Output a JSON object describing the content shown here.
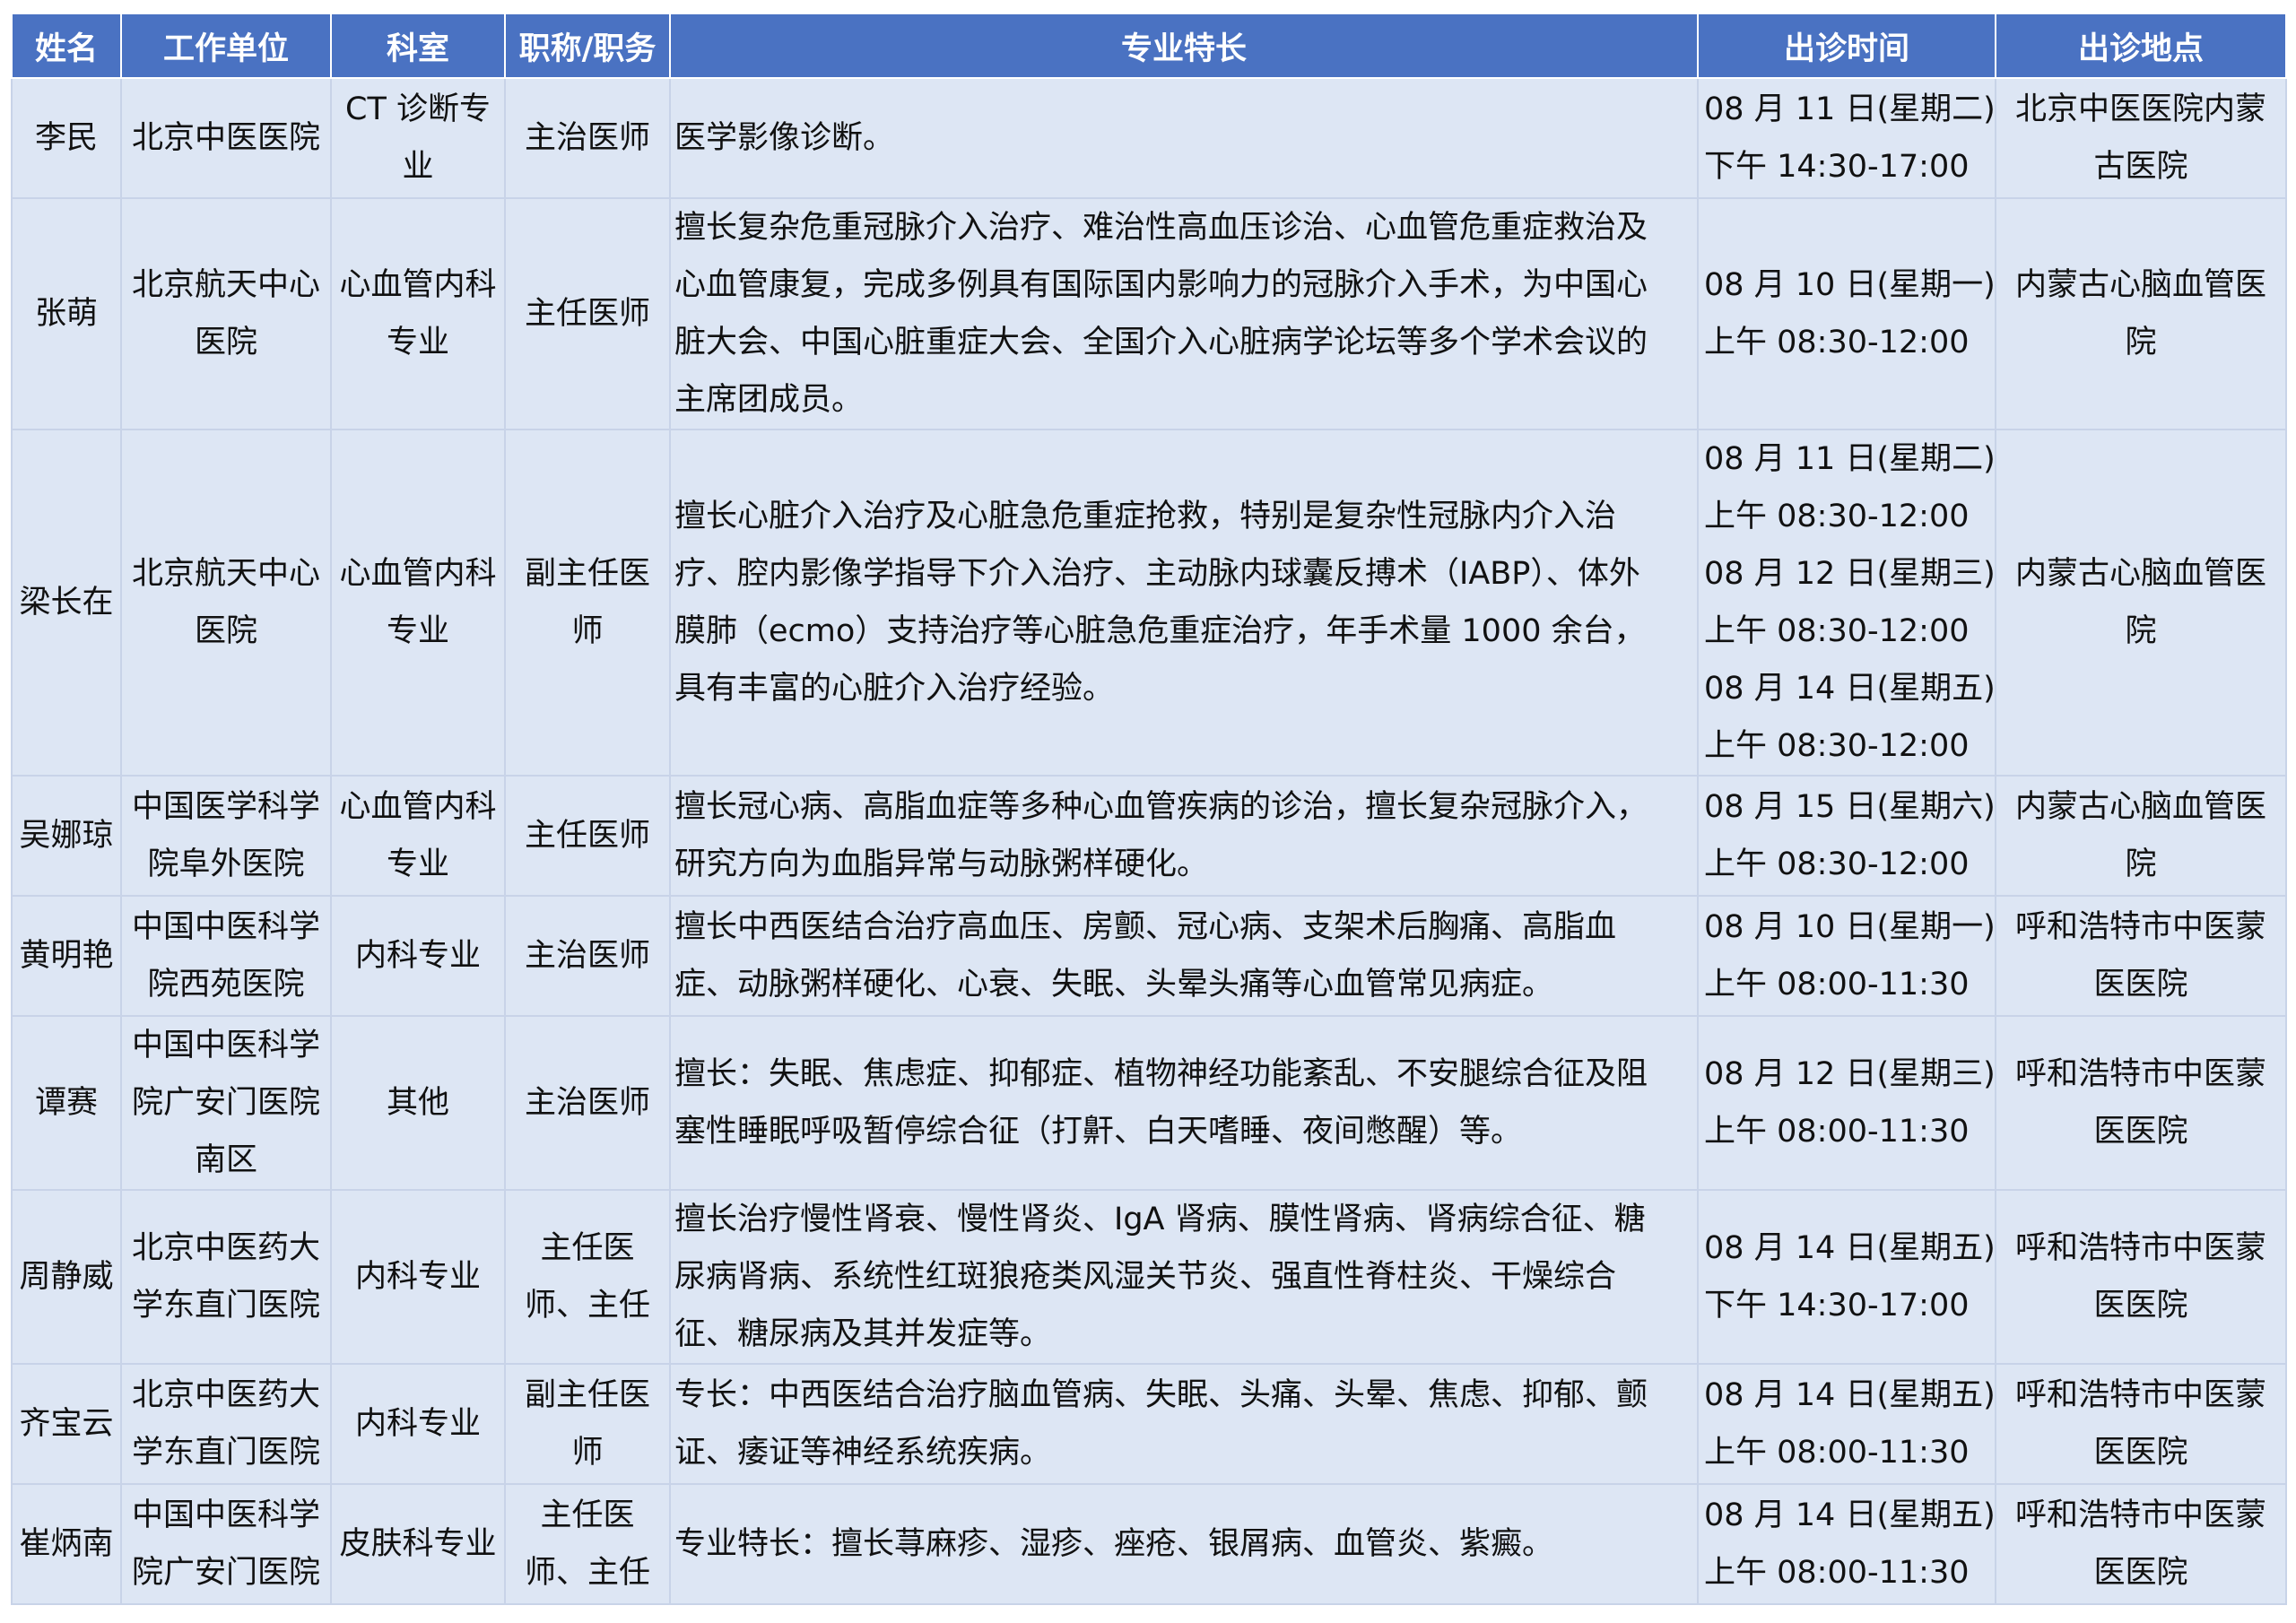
{
  "header": {
    "name": "姓名",
    "unit": "工作单位",
    "dept": "科室",
    "title": "职称/职务",
    "specialty": "专业特长",
    "time": "出诊时间",
    "place": "出诊地点"
  },
  "rows": [
    {
      "name": [
        "李民"
      ],
      "unit": [
        "北京中医医院"
      ],
      "dept": [
        "CT 诊断专",
        "业"
      ],
      "title": [
        "主治医师"
      ],
      "specialty": [
        "医学影像诊断。"
      ],
      "time": [
        "08 月 11 日(星期二)",
        "下午 14:30-17:00"
      ],
      "place": [
        "北京中医医院内蒙",
        "古医院"
      ]
    },
    {
      "name": [
        "张萌"
      ],
      "unit": [
        "北京航天中心",
        "医院"
      ],
      "dept": [
        "心血管内科",
        "专业"
      ],
      "title": [
        "主任医师"
      ],
      "specialty": [
        "擅长复杂危重冠脉介入治疗、难治性高血压诊治、心血管危重症救治及",
        "心血管康复，完成多例具有国际国内影响力的冠脉介入手术，为中国心",
        "脏大会、中国心脏重症大会、全国介入心脏病学论坛等多个学术会议的",
        "主席团成员。"
      ],
      "time": [
        "08 月 10 日(星期一)",
        "上午 08:30-12:00"
      ],
      "place": [
        "内蒙古心脑血管医",
        "院"
      ]
    },
    {
      "name": [
        "梁长在"
      ],
      "unit": [
        "北京航天中心",
        "医院"
      ],
      "dept": [
        "心血管内科",
        "专业"
      ],
      "title": [
        "副主任医",
        "师"
      ],
      "specialty": [
        "擅长心脏介入治疗及心脏急危重症抢救，特别是复杂性冠脉内介入治",
        "疗、腔内影像学指导下介入治疗、主动脉内球囊反搏术（IABP）、体外",
        "膜肺（ecmo）支持治疗等心脏急危重症治疗，年手术量 1000 余台，",
        "具有丰富的心脏介入治疗经验。"
      ],
      "time": [
        "08 月 11 日(星期二)",
        "上午 08:30-12:00",
        "08 月 12 日(星期三)",
        "上午 08:30-12:00",
        "08 月 14 日(星期五)",
        "上午 08:30-12:00"
      ],
      "place": [
        "内蒙古心脑血管医",
        "院"
      ]
    },
    {
      "name": [
        "吴娜琼"
      ],
      "unit": [
        "中国医学科学",
        "院阜外医院"
      ],
      "dept": [
        "心血管内科",
        "专业"
      ],
      "title": [
        "主任医师"
      ],
      "specialty": [
        "擅长冠心病、高脂血症等多种心血管疾病的诊治，擅长复杂冠脉介入，",
        "研究方向为血脂异常与动脉粥样硬化。"
      ],
      "time": [
        "08 月 15 日(星期六)",
        "上午 08:30-12:00"
      ],
      "place": [
        "内蒙古心脑血管医",
        "院"
      ]
    },
    {
      "name": [
        "黄明艳"
      ],
      "unit": [
        "中国中医科学",
        "院西苑医院"
      ],
      "dept": [
        "内科专业"
      ],
      "title": [
        "主治医师"
      ],
      "specialty": [
        "擅长中西医结合治疗高血压、房颤、冠心病、支架术后胸痛、高脂血",
        "症、动脉粥样硬化、心衰、失眠、头晕头痛等心血管常见病症。"
      ],
      "time": [
        "08 月 10 日(星期一)",
        "上午 08:00-11:30"
      ],
      "place": [
        "呼和浩特市中医蒙",
        "医医院"
      ]
    },
    {
      "name": [
        "谭赛"
      ],
      "unit": [
        "中国中医科学",
        "院广安门医院",
        "南区"
      ],
      "dept": [
        "其他"
      ],
      "title": [
        "主治医师"
      ],
      "specialty": [
        "擅长：失眠、焦虑症、抑郁症、植物神经功能紊乱、不安腿综合征及阻",
        "塞性睡眠呼吸暂停综合征（打鼾、白天嗜睡、夜间憋醒）等。"
      ],
      "time": [
        "08 月 12 日(星期三)",
        "上午 08:00-11:30"
      ],
      "place": [
        "呼和浩特市中医蒙",
        "医医院"
      ]
    },
    {
      "name": [
        "周静威"
      ],
      "unit": [
        "北京中医药大",
        "学东直门医院"
      ],
      "dept": [
        "内科专业"
      ],
      "title": [
        "主任医",
        "师、主任"
      ],
      "specialty": [
        "擅长治疗慢性肾衰、慢性肾炎、IgA 肾病、膜性肾病、肾病综合征、糖",
        "尿病肾病、系统性红斑狼疮类风湿关节炎、强直性脊柱炎、干燥综合",
        "征、糖尿病及其并发症等。"
      ],
      "time": [
        "08 月 14 日(星期五)",
        "下午 14:30-17:00"
      ],
      "place": [
        "呼和浩特市中医蒙",
        "医医院"
      ]
    },
    {
      "name": [
        "齐宝云"
      ],
      "unit": [
        "北京中医药大",
        "学东直门医院"
      ],
      "dept": [
        "内科专业"
      ],
      "title": [
        "副主任医",
        "师"
      ],
      "specialty": [
        "专长：中西医结合治疗脑血管病、失眠、头痛、头晕、焦虑、抑郁、颤",
        "证、痿证等神经系统疾病。"
      ],
      "time": [
        "08 月 14 日(星期五)",
        "上午 08:00-11:30"
      ],
      "place": [
        "呼和浩特市中医蒙",
        "医医院"
      ]
    },
    {
      "name": [
        "崔炳南"
      ],
      "unit": [
        "中国中医科学",
        "院广安门医院"
      ],
      "dept": [
        "皮肤科专业"
      ],
      "title": [
        "主任医",
        "师、主任"
      ],
      "specialty": [
        "专业特长：擅长荨麻疹、湿疹、痤疮、银屑病、血管炎、紫癜。"
      ],
      "time": [
        "08 月 14 日(星期五)",
        "上午 08:00-11:30"
      ],
      "place": [
        "呼和浩特市中医蒙",
        "医医院"
      ]
    }
  ],
  "colors": {
    "header_bg": "#4a72c2",
    "header_text": "#ffffff",
    "cell_bg": "#dde6f4",
    "border": "#c8d3e8"
  }
}
